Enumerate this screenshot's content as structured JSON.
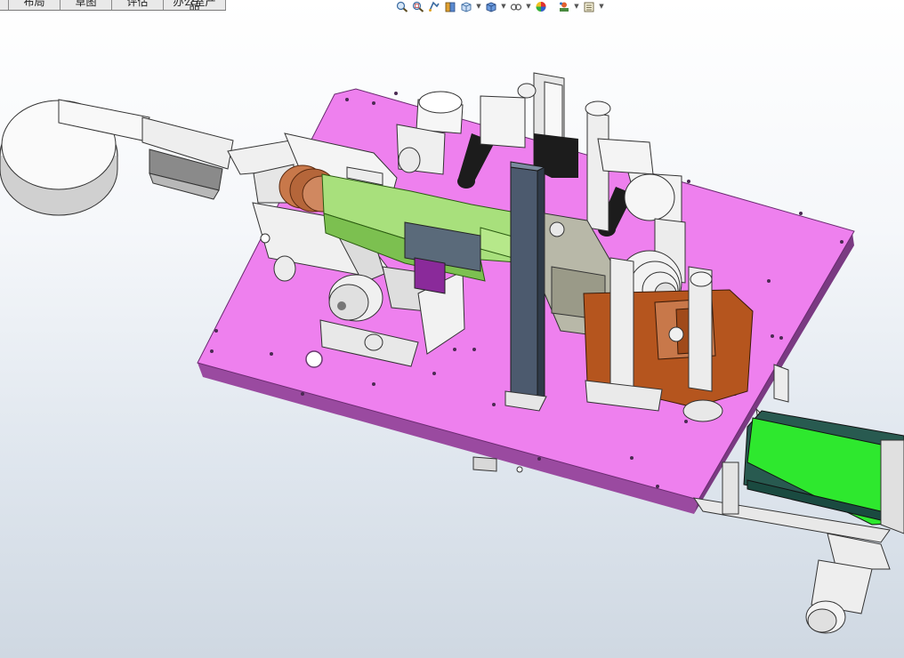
{
  "tabs": [
    {
      "label": ""
    },
    {
      "label": "布局"
    },
    {
      "label": "草图"
    },
    {
      "label": "评估"
    },
    {
      "label": "办公室产品"
    }
  ],
  "heads_up_toolbar": [
    {
      "icon": "zoom-to-fit-icon",
      "caret": false
    },
    {
      "icon": "zoom-to-area-icon",
      "caret": false
    },
    {
      "icon": "previous-view-icon",
      "caret": false
    },
    {
      "icon": "section-view-icon",
      "caret": false
    },
    {
      "icon": "view-orientation-icon",
      "caret": true
    },
    {
      "icon": "display-style-icon",
      "caret": true
    },
    {
      "icon": "hide-show-items-icon",
      "caret": true
    },
    {
      "icon": "edit-appearance-icon",
      "caret": false
    },
    {
      "icon": "apply-scene-icon",
      "caret": true
    },
    {
      "icon": "view-settings-icon",
      "caret": true
    }
  ],
  "colors": {
    "base_plate": "#ee80ee",
    "base_plate_edge": "#9a4aa0",
    "green_part": "#a8e07c",
    "bright_green": "#2ee82e",
    "dark_belt": "#285a50",
    "orange_part": "#b5551e",
    "copper_part": "#c8784a",
    "steel": "#e8e8e8",
    "steel_dark": "#4c5a6e",
    "black": "#1c1c1c"
  }
}
